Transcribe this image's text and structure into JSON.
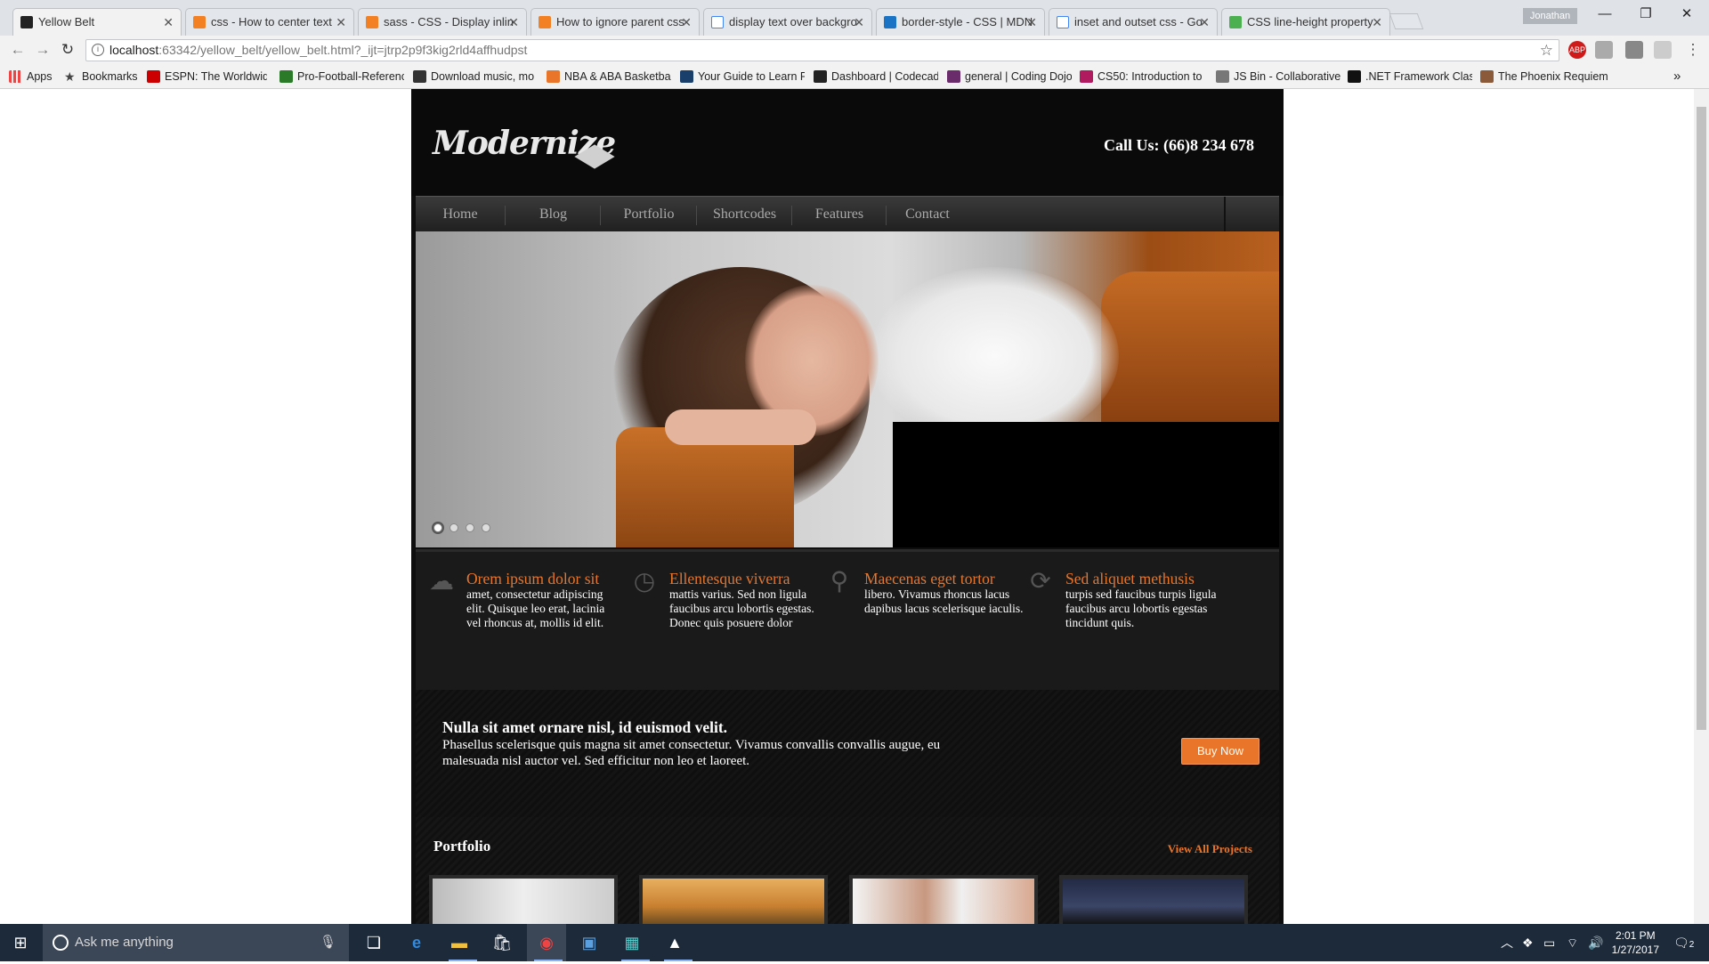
{
  "browser": {
    "tabs": [
      {
        "title": "Yellow Belt",
        "active": true,
        "favicon": "ws-icon"
      },
      {
        "title": "css - How to center text",
        "favicon": "stackoverflow-icon"
      },
      {
        "title": "sass - CSS - Display inlin",
        "favicon": "stackoverflow-icon"
      },
      {
        "title": "How to ignore parent css",
        "favicon": "stackoverflow-icon"
      },
      {
        "title": "display text over backgro",
        "favicon": "google-icon"
      },
      {
        "title": "border-style - CSS | MDN",
        "favicon": "mdn-icon"
      },
      {
        "title": "inset and outset css - Go",
        "favicon": "google-icon"
      },
      {
        "title": "CSS line-height property",
        "favicon": "w3schools-icon"
      }
    ],
    "profile": "Jonathan",
    "url_host": "localhost",
    "url_rest": ":63342/yellow_belt/yellow_belt.html?_ijt=jtrp2p9f3kig2rld4affhudpst",
    "bookmarks": [
      {
        "label": "Apps"
      },
      {
        "label": "Bookmarks"
      },
      {
        "label": "ESPN: The Worldwide"
      },
      {
        "label": "Pro-Football-Referenc"
      },
      {
        "label": "Download music, mo"
      },
      {
        "label": "NBA & ABA Basketba"
      },
      {
        "label": "Your Guide to Learn P"
      },
      {
        "label": "Dashboard | Codecad"
      },
      {
        "label": "general | Coding Dojo"
      },
      {
        "label": "CS50: Introduction to"
      },
      {
        "label": "JS Bin - Collaborative"
      },
      {
        "label": ".NET Framework Class"
      },
      {
        "label": "The Phoenix Requiem"
      }
    ],
    "bookmarks_more": "»",
    "abp_label": "ABP"
  },
  "site": {
    "logo": "Modernize",
    "call_us": "Call Us: (66)8 234 678",
    "nav": [
      "Home",
      "Blog",
      "Portfolio",
      "Shortcodes",
      "Features",
      "Contact"
    ],
    "slider_dots": 4,
    "features": [
      {
        "icon": "cloud-icon",
        "title": "Orem ipsum dolor sit",
        "text": "amet, consectetur adipiscing elit. Quisque leo erat, lacinia vel rhoncus at, mollis id elit."
      },
      {
        "icon": "clock-icon",
        "title": "Ellentesque viverra",
        "text": "mattis varius. Sed non ligula faucibus arcu lobortis egestas. Donec quis posuere dolor"
      },
      {
        "icon": "map-pin-icon",
        "title": "Maecenas eget tortor",
        "text": "libero. Vivamus rhoncus lacus dapibus lacus scelerisque iaculis."
      },
      {
        "icon": "refresh-icon",
        "title": "Sed aliquet methusis",
        "text": "turpis sed faucibus turpis ligula faucibus arcu lobortis egestas tincidunt quis."
      }
    ],
    "promo": {
      "title": "Nulla sit amet ornare nisl, id euismod velit.",
      "text": "Phasellus scelerisque quis magna sit amet consectetur. Vivamus convallis convallis augue, eu malesuada nisl auctor vel. Sed efficitur non leo et laoreet.",
      "button": "Buy Now"
    },
    "portfolio": {
      "title": "Portfolio",
      "link": "View All Projects"
    },
    "accent": "#e8752a"
  },
  "taskbar": {
    "search_placeholder": "Ask me anything",
    "time": "2:01 PM",
    "date": "1/27/2017",
    "notifications": "2"
  }
}
